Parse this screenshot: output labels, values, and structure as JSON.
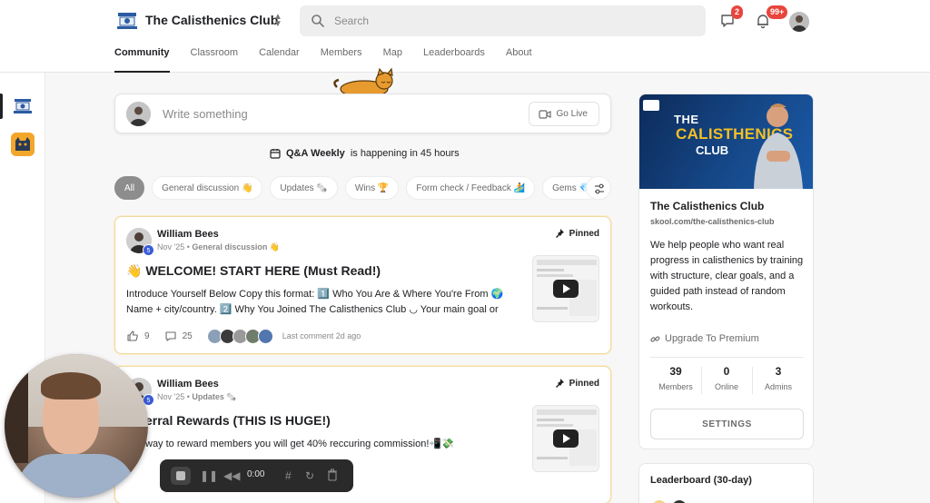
{
  "header": {
    "brand": "The Calisthenics Club",
    "search_placeholder": "Search",
    "chat_badge": "2",
    "notif_badge": "99+"
  },
  "nav": {
    "tabs": [
      "Community",
      "Classroom",
      "Calendar",
      "Members",
      "Map",
      "Leaderboards",
      "About"
    ],
    "active": "Community"
  },
  "composer": {
    "placeholder": "Write something",
    "go_live": "Go Live"
  },
  "event": {
    "name": "Q&A Weekly",
    "suffix": "is happening in 45 hours"
  },
  "filters": [
    "All",
    "General discussion 👋",
    "Updates 🗞️",
    "Wins 🏆",
    "Form check / Feedback 🏄",
    "Gems 💎"
  ],
  "posts": [
    {
      "author": "William Bees",
      "level": "5",
      "date": "Nov '25",
      "category": "General discussion 👋",
      "pinned": "Pinned",
      "title": "👋 WELCOME! START HERE (Must Read!)",
      "excerpt": "Introduce Yourself Below Copy this format: 1️⃣ Who You Are & Where You're From 🌍 Name + city/country. 2️⃣ Why You Joined The Calisthenics Club ◡ Your main goal or",
      "likes": "9",
      "comments": "25",
      "last_comment": "Last comment 2d ago"
    },
    {
      "author": "William Bees",
      "level": "5",
      "date": "Nov '25",
      "category": "Updates 🗞️",
      "pinned": "Pinned",
      "title": "erral Rewards (THIS IS HUGE!)",
      "excerpt": "way to reward members you will get 40% reccuring commission!📲💸",
      "likes": "",
      "comments": "",
      "last_comment": ""
    }
  ],
  "about": {
    "banner_line1": "THE",
    "banner_line2": "CALISTHENICS",
    "banner_line3": "CLUB",
    "name": "The Calisthenics Club",
    "url": "skool.com/the-calisthenics-club",
    "description": "We help people who want real progress in calisthenics by training with structure, clear goals, and a guided path instead of random workouts.",
    "upgrade": "Upgrade To Premium",
    "stats": [
      {
        "value": "39",
        "label": "Members"
      },
      {
        "value": "0",
        "label": "Online"
      },
      {
        "value": "3",
        "label": "Admins"
      }
    ],
    "settings": "SETTINGS"
  },
  "leaderboard": {
    "title": "Leaderboard (30-day)"
  },
  "recorder": {
    "time": "0:00"
  }
}
